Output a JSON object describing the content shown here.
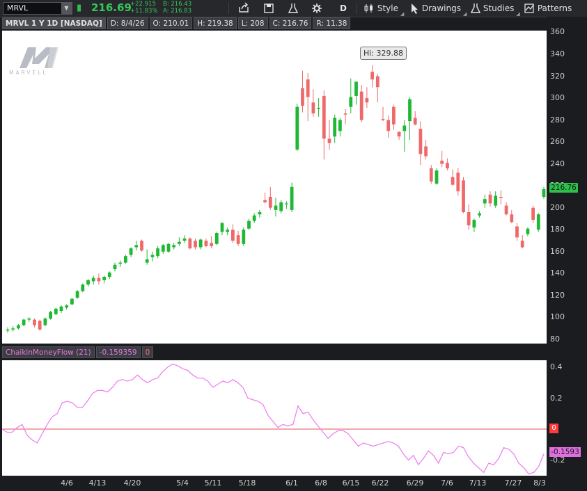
{
  "toolbar": {
    "symbol": "MRVL",
    "last": "216.69",
    "net_change": "+22.915",
    "pct_change": "+11.83%",
    "bid": "B: 216.43",
    "ask": "A: 216.83",
    "aggregation": "D",
    "style_label": "Style",
    "drawings_label": "Drawings",
    "studies_label": "Studies",
    "patterns_label": "Patterns"
  },
  "info_bar": {
    "title": "MRVL 1 Y 1D [NASDAQ]",
    "date": "D: 8/4/26",
    "open": "O: 210.01",
    "high": "H: 219.38",
    "low": "L: 208",
    "close": "C: 216.76",
    "range": "R: 11.38"
  },
  "logo_text": "MARVELL",
  "price_tag": "216.76",
  "hi_label": "Hi: 329.88",
  "study": {
    "name": "ChaikinMoneyFlow (21)",
    "value": "-0.159359",
    "zero": "0",
    "tag": "-0.1593",
    "zero_tag": "0"
  },
  "colors": {
    "up": "#1fb834",
    "down": "#ee6a6a",
    "cmf_line": "#ee82ee",
    "zero_line": "#e05050",
    "accent": "#35c759"
  },
  "chart_data": [
    {
      "type": "candlestick",
      "ylim": [
        80,
        360
      ],
      "yticks": [
        "80",
        "100",
        "120",
        "140",
        "160",
        "180",
        "200",
        "220",
        "240",
        "260",
        "280",
        "300",
        "320",
        "340",
        "360"
      ],
      "x_tick_labels": [
        "4/6",
        "4/13",
        "4/20",
        "5/4",
        "5/11",
        "5/18",
        "6/1",
        "6/8",
        "6/15",
        "6/22",
        "6/29",
        "7/6",
        "7/13",
        "7/27",
        "8/3"
      ],
      "candles": [
        {
          "o": 88,
          "h": 91,
          "l": 86,
          "c": 89
        },
        {
          "o": 89,
          "h": 92,
          "l": 87,
          "c": 90
        },
        {
          "o": 90,
          "h": 94,
          "l": 89,
          "c": 93
        },
        {
          "o": 93,
          "h": 99,
          "l": 92,
          "c": 98
        },
        {
          "o": 98,
          "h": 100,
          "l": 96,
          "c": 99
        },
        {
          "o": 98,
          "h": 99,
          "l": 91,
          "c": 93
        },
        {
          "o": 97,
          "h": 98,
          "l": 88,
          "c": 89
        },
        {
          "o": 93,
          "h": 100,
          "l": 92,
          "c": 99
        },
        {
          "o": 99,
          "h": 106,
          "l": 98,
          "c": 105
        },
        {
          "o": 103,
          "h": 109,
          "l": 102,
          "c": 108
        },
        {
          "o": 106,
          "h": 111,
          "l": 104,
          "c": 110
        },
        {
          "o": 109,
          "h": 112,
          "l": 107,
          "c": 111
        },
        {
          "o": 112,
          "h": 118,
          "l": 111,
          "c": 117
        },
        {
          "o": 118,
          "h": 125,
          "l": 117,
          "c": 124
        },
        {
          "o": 124,
          "h": 131,
          "l": 123,
          "c": 130
        },
        {
          "o": 130,
          "h": 135,
          "l": 128,
          "c": 134
        },
        {
          "o": 133,
          "h": 138,
          "l": 130,
          "c": 136
        },
        {
          "o": 136,
          "h": 140,
          "l": 130,
          "c": 133
        },
        {
          "o": 134,
          "h": 138,
          "l": 131,
          "c": 137
        },
        {
          "o": 137,
          "h": 142,
          "l": 135,
          "c": 141
        },
        {
          "o": 144,
          "h": 150,
          "l": 142,
          "c": 148
        },
        {
          "o": 149,
          "h": 152,
          "l": 146,
          "c": 150
        },
        {
          "o": 150,
          "h": 157,
          "l": 149,
          "c": 156
        },
        {
          "o": 157,
          "h": 164,
          "l": 155,
          "c": 163
        },
        {
          "o": 164,
          "h": 170,
          "l": 161,
          "c": 166
        },
        {
          "o": 170,
          "h": 171,
          "l": 160,
          "c": 161
        },
        {
          "o": 150,
          "h": 162,
          "l": 148,
          "c": 153
        },
        {
          "o": 155,
          "h": 160,
          "l": 151,
          "c": 157
        },
        {
          "o": 156,
          "h": 165,
          "l": 154,
          "c": 163
        },
        {
          "o": 160,
          "h": 167,
          "l": 158,
          "c": 166
        },
        {
          "o": 160,
          "h": 168,
          "l": 159,
          "c": 167
        },
        {
          "o": 164,
          "h": 168,
          "l": 162,
          "c": 166
        },
        {
          "o": 167,
          "h": 173,
          "l": 165,
          "c": 169
        },
        {
          "o": 170,
          "h": 175,
          "l": 168,
          "c": 172
        },
        {
          "o": 172,
          "h": 173,
          "l": 162,
          "c": 163
        },
        {
          "o": 170,
          "h": 172,
          "l": 162,
          "c": 164
        },
        {
          "o": 164,
          "h": 172,
          "l": 162,
          "c": 171
        },
        {
          "o": 170,
          "h": 172,
          "l": 164,
          "c": 165
        },
        {
          "o": 168,
          "h": 174,
          "l": 163,
          "c": 165
        },
        {
          "o": 167,
          "h": 178,
          "l": 166,
          "c": 177
        },
        {
          "o": 178,
          "h": 187,
          "l": 175,
          "c": 186
        },
        {
          "o": 178,
          "h": 182,
          "l": 175,
          "c": 180
        },
        {
          "o": 180,
          "h": 185,
          "l": 168,
          "c": 170
        },
        {
          "o": 175,
          "h": 179,
          "l": 165,
          "c": 167
        },
        {
          "o": 167,
          "h": 182,
          "l": 165,
          "c": 180
        },
        {
          "o": 181,
          "h": 190,
          "l": 180,
          "c": 188
        },
        {
          "o": 188,
          "h": 195,
          "l": 186,
          "c": 193
        },
        {
          "o": 194,
          "h": 198,
          "l": 191,
          "c": 196
        },
        {
          "o": 207,
          "h": 214,
          "l": 204,
          "c": 205
        },
        {
          "o": 210,
          "h": 219,
          "l": 198,
          "c": 200
        },
        {
          "o": 198,
          "h": 209,
          "l": 192,
          "c": 202
        },
        {
          "o": 197,
          "h": 207,
          "l": 195,
          "c": 205
        },
        {
          "o": 204,
          "h": 206,
          "l": 199,
          "c": 204
        },
        {
          "o": 198,
          "h": 223,
          "l": 196,
          "c": 219
        },
        {
          "o": 253,
          "h": 295,
          "l": 252,
          "c": 292
        },
        {
          "o": 309,
          "h": 325,
          "l": 287,
          "c": 293
        },
        {
          "o": 317,
          "h": 323,
          "l": 279,
          "c": 301
        },
        {
          "o": 296,
          "h": 308,
          "l": 283,
          "c": 286
        },
        {
          "o": 290,
          "h": 300,
          "l": 283,
          "c": 291
        },
        {
          "o": 302,
          "h": 307,
          "l": 244,
          "c": 263
        },
        {
          "o": 263,
          "h": 280,
          "l": 253,
          "c": 259
        },
        {
          "o": 265,
          "h": 285,
          "l": 259,
          "c": 282
        },
        {
          "o": 270,
          "h": 282,
          "l": 265,
          "c": 280
        },
        {
          "o": 286,
          "h": 290,
          "l": 276,
          "c": 285
        },
        {
          "o": 292,
          "h": 318,
          "l": 286,
          "c": 301
        },
        {
          "o": 302,
          "h": 314,
          "l": 294,
          "c": 315
        },
        {
          "o": 306,
          "h": 312,
          "l": 278,
          "c": 280
        },
        {
          "o": 300,
          "h": 310,
          "l": 291,
          "c": 296
        },
        {
          "o": 324,
          "h": 330,
          "l": 310,
          "c": 317
        },
        {
          "o": 320,
          "h": 322,
          "l": 296,
          "c": 310
        },
        {
          "o": 281,
          "h": 292,
          "l": 279,
          "c": 280
        },
        {
          "o": 280,
          "h": 284,
          "l": 264,
          "c": 270
        },
        {
          "o": 292,
          "h": 294,
          "l": 271,
          "c": 276
        },
        {
          "o": 269,
          "h": 270,
          "l": 262,
          "c": 265
        },
        {
          "o": 270,
          "h": 280,
          "l": 251,
          "c": 275
        },
        {
          "o": 279,
          "h": 301,
          "l": 262,
          "c": 299
        },
        {
          "o": 282,
          "h": 288,
          "l": 275,
          "c": 276
        },
        {
          "o": 272,
          "h": 279,
          "l": 239,
          "c": 249
        },
        {
          "o": 256,
          "h": 262,
          "l": 244,
          "c": 247
        },
        {
          "o": 236,
          "h": 239,
          "l": 222,
          "c": 224
        },
        {
          "o": 222,
          "h": 236,
          "l": 221,
          "c": 234
        },
        {
          "o": 243,
          "h": 252,
          "l": 237,
          "c": 240
        },
        {
          "o": 241,
          "h": 245,
          "l": 234,
          "c": 236
        },
        {
          "o": 228,
          "h": 235,
          "l": 220,
          "c": 221
        },
        {
          "o": 232,
          "h": 236,
          "l": 211,
          "c": 215
        },
        {
          "o": 225,
          "h": 228,
          "l": 195,
          "c": 196
        },
        {
          "o": 196,
          "h": 203,
          "l": 180,
          "c": 184
        },
        {
          "o": 182,
          "h": 190,
          "l": 178,
          "c": 189
        },
        {
          "o": 193,
          "h": 197,
          "l": 191,
          "c": 195
        },
        {
          "o": 204,
          "h": 212,
          "l": 200,
          "c": 208
        },
        {
          "o": 212,
          "h": 215,
          "l": 201,
          "c": 204
        },
        {
          "o": 202,
          "h": 215,
          "l": 200,
          "c": 211
        },
        {
          "o": 210,
          "h": 216,
          "l": 203,
          "c": 209
        },
        {
          "o": 202,
          "h": 205,
          "l": 193,
          "c": 194
        },
        {
          "o": 194,
          "h": 198,
          "l": 186,
          "c": 187
        },
        {
          "o": 183,
          "h": 186,
          "l": 170,
          "c": 173
        },
        {
          "o": 170,
          "h": 175,
          "l": 163,
          "c": 164
        },
        {
          "o": 176,
          "h": 182,
          "l": 174,
          "c": 181
        },
        {
          "o": 200,
          "h": 202,
          "l": 186,
          "c": 189
        },
        {
          "o": 180,
          "h": 195,
          "l": 178,
          "c": 194
        },
        {
          "o": 210,
          "h": 219,
          "l": 208,
          "c": 217
        }
      ]
    },
    {
      "type": "line",
      "name": "ChaikinMoneyFlow (21)",
      "ylim": [
        -0.32,
        0.48
      ],
      "yticks": [
        "-0.2",
        "0.2",
        "0.4"
      ],
      "reference_line": 0,
      "values": [
        0.0,
        -0.02,
        -0.02,
        0.01,
        0.03,
        -0.04,
        -0.07,
        -0.09,
        -0.03,
        0.03,
        0.08,
        0.1,
        0.17,
        0.18,
        0.17,
        0.14,
        0.14,
        0.18,
        0.23,
        0.25,
        0.25,
        0.24,
        0.27,
        0.31,
        0.32,
        0.31,
        0.32,
        0.35,
        0.32,
        0.3,
        0.32,
        0.33,
        0.37,
        0.4,
        0.42,
        0.41,
        0.39,
        0.38,
        0.35,
        0.33,
        0.33,
        0.31,
        0.27,
        0.29,
        0.31,
        0.3,
        0.32,
        0.3,
        0.27,
        0.2,
        0.19,
        0.18,
        0.16,
        0.09,
        0.05,
        0.01,
        0.03,
        0.02,
        0.03,
        0.15,
        0.1,
        0.11,
        0.06,
        0.02,
        -0.02,
        -0.06,
        -0.03,
        -0.01,
        -0.01,
        -0.03,
        -0.07,
        -0.11,
        -0.09,
        -0.1,
        -0.11,
        -0.1,
        -0.09,
        -0.08,
        -0.09,
        -0.11,
        -0.16,
        -0.2,
        -0.17,
        -0.23,
        -0.19,
        -0.14,
        -0.17,
        -0.22,
        -0.15,
        -0.16,
        -0.15,
        -0.11,
        -0.12,
        -0.18,
        -0.22,
        -0.25,
        -0.28,
        -0.22,
        -0.23,
        -0.19,
        -0.12,
        -0.13,
        -0.16,
        -0.22,
        -0.25,
        -0.29,
        -0.28,
        -0.24,
        -0.16
      ]
    }
  ]
}
